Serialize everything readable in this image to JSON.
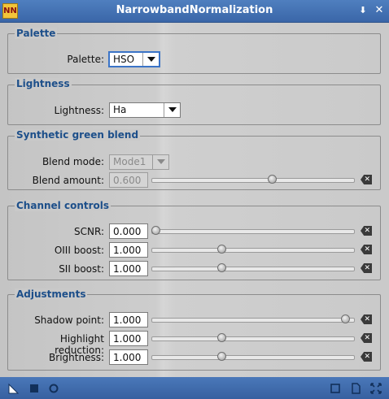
{
  "window": {
    "title": "NarrowbandNormalization",
    "app_icon_text": "NN"
  },
  "palette": {
    "group_title": "Palette",
    "label": "Palette:",
    "value": "HSO"
  },
  "lightness": {
    "group_title": "Lightness",
    "label": "Lightness:",
    "value": "Ha"
  },
  "synthetic_green": {
    "group_title": "Synthetic green blend",
    "blend_mode_label": "Blend mode:",
    "blend_mode_value": "Mode1",
    "blend_amount_label": "Blend amount:",
    "blend_amount_value": "0.600",
    "blend_amount_level": 0.6
  },
  "channel_controls": {
    "group_title": "Channel controls",
    "rows": [
      {
        "label": "SCNR:",
        "value": "0.000",
        "level": 0.0
      },
      {
        "label": "OIII boost:",
        "value": "1.000",
        "level": 0.34
      },
      {
        "label": "SII boost:",
        "value": "1.000",
        "level": 0.34
      }
    ]
  },
  "adjustments": {
    "group_title": "Adjustments",
    "rows": [
      {
        "label": "Shadow point:",
        "value": "1.000",
        "level": 0.98
      },
      {
        "label": "Highlight reduction:",
        "value": "1.000",
        "level": 0.34
      },
      {
        "label": "Brightness:",
        "value": "1.000",
        "level": 0.34
      }
    ]
  },
  "colors": {
    "title_bar": "#3a66a8",
    "group_title": "#1d4f8a",
    "focus": "#3b74c7"
  },
  "icons": {
    "titlebar": [
      "shade-icon",
      "close-icon"
    ],
    "bottom_left": [
      "new-instance-icon",
      "apply-global-icon",
      "apply-icon"
    ],
    "bottom_right": [
      "preview-icon",
      "documentation-icon",
      "reset-all-icon"
    ]
  }
}
